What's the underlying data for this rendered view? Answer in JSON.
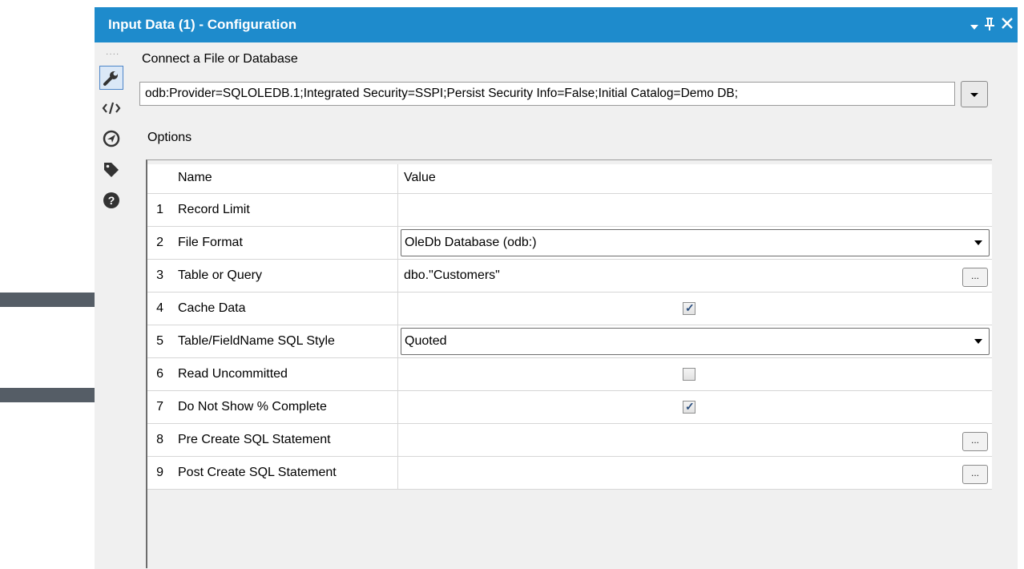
{
  "window": {
    "title": "Input Data (1) - Configuration"
  },
  "icons": [
    "dropdown-icon",
    "pin-icon",
    "close-icon",
    "wrench-icon",
    "xml-icon",
    "navigate-icon",
    "tag-icon",
    "help-icon"
  ],
  "connect": {
    "label": "Connect a File or Database",
    "value": "odb:Provider=SQLOLEDB.1;Integrated Security=SSPI;Persist Security Info=False;Initial Catalog=Demo DB;"
  },
  "options": {
    "label": "Options",
    "headers": {
      "name": "Name",
      "value": "Value"
    },
    "rows": [
      {
        "num": "1",
        "name": "Record Limit",
        "value": ""
      },
      {
        "num": "2",
        "name": "File Format",
        "value": "OleDb Database (odb:)"
      },
      {
        "num": "3",
        "name": "Table or Query",
        "value": "dbo.\"Customers\"",
        "button": "..."
      },
      {
        "num": "4",
        "name": "Cache Data",
        "checked": true
      },
      {
        "num": "5",
        "name": "Table/FieldName SQL Style",
        "value": "Quoted"
      },
      {
        "num": "6",
        "name": "Read Uncommitted",
        "checked": false
      },
      {
        "num": "7",
        "name": "Do Not Show % Complete",
        "checked": true
      },
      {
        "num": "8",
        "name": "Pre Create SQL Statement",
        "value": "",
        "button": "..."
      },
      {
        "num": "9",
        "name": "Post Create SQL Statement",
        "value": "",
        "button": "..."
      }
    ]
  },
  "colors": {
    "titlebar": "#1e8bcc",
    "arrow": "#555d66"
  }
}
